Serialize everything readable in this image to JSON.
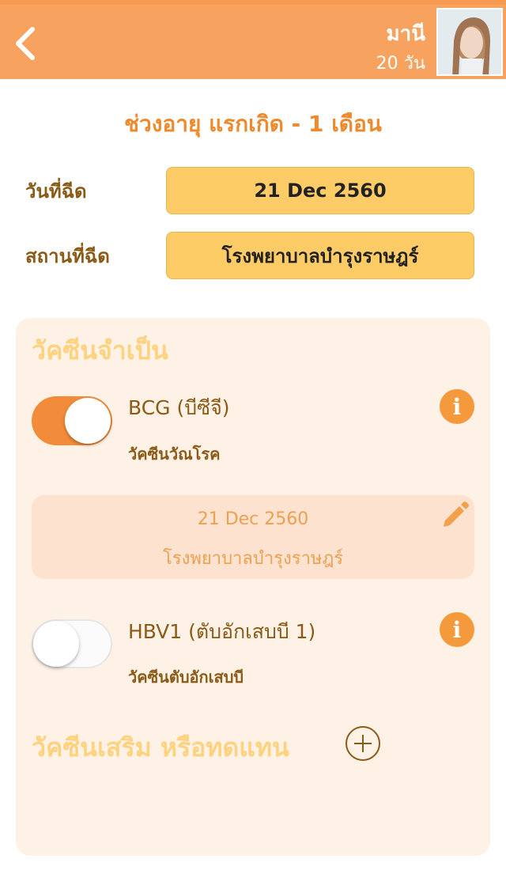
{
  "header": {
    "back_icon": "chevron-left-icon",
    "user_name": "มานี",
    "user_age": "20 วัน"
  },
  "age_range": "ช่วงอายุ แรกเกิด - 1 เดือน",
  "form": {
    "date_label": "วันที่ฉีด",
    "date_value": "21 Dec 2560",
    "place_label": "สถานที่ฉีด",
    "place_value": "โรงพยาบาลบำรุงราษฎร์"
  },
  "required_section": {
    "title": "วัคซีนจำเป็น",
    "vaccines": [
      {
        "name": "BCG (บีซีจี)",
        "description": "วัคซีนวัณโรค",
        "enabled": true,
        "record": {
          "date": "21 Dec 2560",
          "place": "โรงพยาบาลบำรุงราษฎร์"
        }
      },
      {
        "name": "HBV1 (ตับอักเสบบี 1)",
        "description": "วัคซีนตับอักเสบบี",
        "enabled": false
      }
    ],
    "info_icon": "info-icon"
  },
  "optional_section": {
    "title": "วัคซีนเสริม หรือทดแทน",
    "add_icon": "plus-circle-icon"
  },
  "colors": {
    "header": "#f7a35f",
    "accent": "#f28c3a",
    "field": "#fecc66",
    "panel": "#fef1e6",
    "text_brown": "#8a5a16"
  }
}
